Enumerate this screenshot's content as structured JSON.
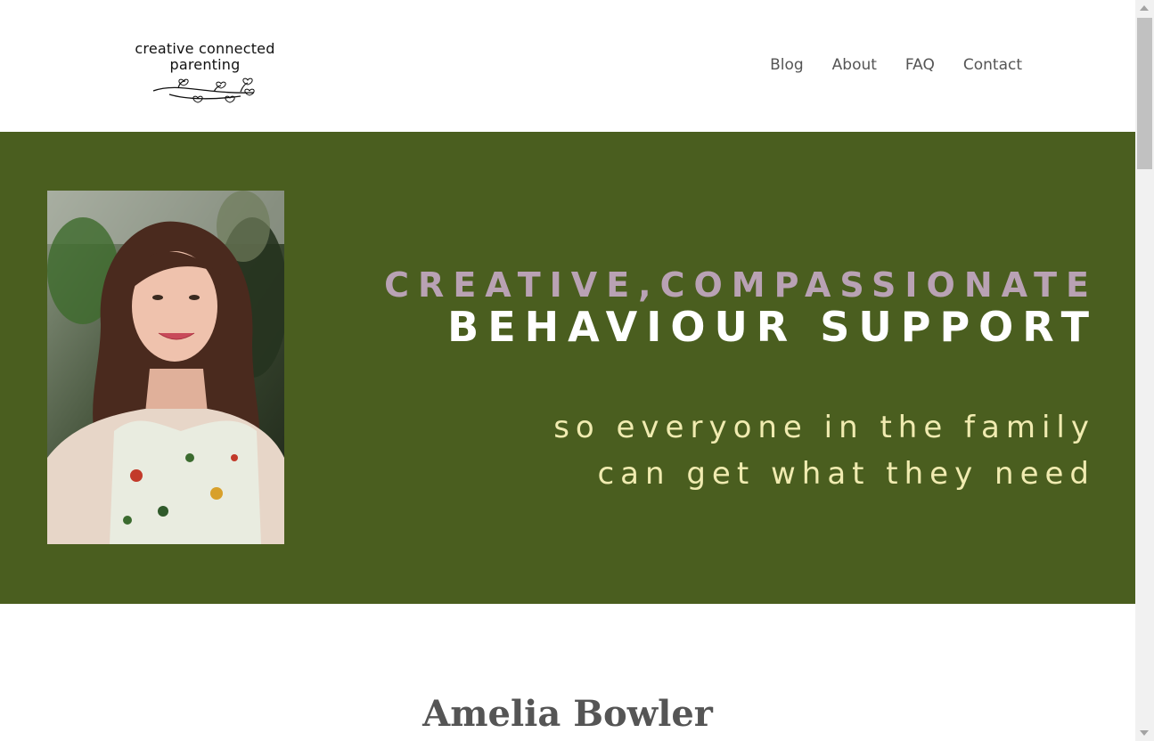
{
  "logo": {
    "line1": "creative connected",
    "line2": "parenting",
    "vine": "vine-hearts-icon"
  },
  "nav": {
    "items": [
      "Blog",
      "About",
      "FAQ",
      "Contact"
    ]
  },
  "hero": {
    "line1": "CREATIVE,COMPASSIONATE",
    "line2": "BEHAVIOUR SUPPORT",
    "sub1": "so everyone in the family",
    "sub2": "can get what they need",
    "background_color": "#4a5e1f"
  },
  "profile": {
    "name": "Amelia Bowler"
  }
}
